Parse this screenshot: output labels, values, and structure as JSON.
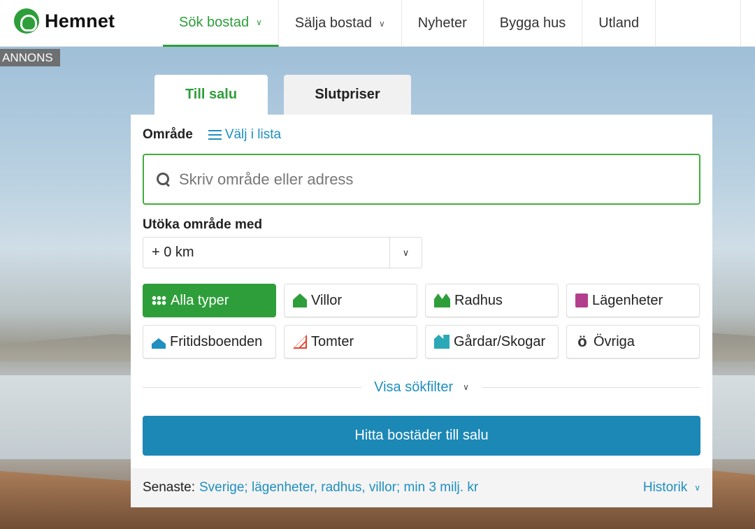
{
  "header": {
    "logo_text": "Hemnet",
    "nav": [
      {
        "label": "Sök bostad",
        "has_dropdown": true,
        "active": true
      },
      {
        "label": "Sälja bostad",
        "has_dropdown": true,
        "active": false
      },
      {
        "label": "Nyheter",
        "has_dropdown": false,
        "active": false
      },
      {
        "label": "Bygga hus",
        "has_dropdown": false,
        "active": false
      },
      {
        "label": "Utland",
        "has_dropdown": false,
        "active": false
      }
    ]
  },
  "ad_label": "ANNONS",
  "tabs": [
    {
      "label": "Till salu",
      "active": true
    },
    {
      "label": "Slutpriser",
      "active": false
    }
  ],
  "search": {
    "area_label": "Område",
    "choose_list_label": "Välj i lista",
    "placeholder": "Skriv område eller adress",
    "value": "",
    "extend_label": "Utöka område med",
    "extend_value": "+ 0 km"
  },
  "property_types": [
    {
      "label": "Alla typer",
      "icon": "grid-dots-icon",
      "selected": true
    },
    {
      "label": "Villor",
      "icon": "house-icon",
      "selected": false
    },
    {
      "label": "Radhus",
      "icon": "townhouse-icon",
      "selected": false
    },
    {
      "label": "Lägenheter",
      "icon": "apartment-icon",
      "selected": false
    },
    {
      "label": "Fritidsboenden",
      "icon": "vacation-house-icon",
      "selected": false
    },
    {
      "label": "Tomter",
      "icon": "plot-icon",
      "selected": false
    },
    {
      "label": "Gårdar/Skogar",
      "icon": "farm-icon",
      "selected": false
    },
    {
      "label": "Övriga",
      "icon": "other-icon",
      "selected": false
    }
  ],
  "filter_toggle_label": "Visa sökfilter",
  "submit_label": "Hitta bostäder till salu",
  "recent": {
    "label": "Senaste:",
    "value": "Sverige; lägenheter, radhus, villor; min 3 milj. kr",
    "history_label": "Historik"
  },
  "colors": {
    "brand_green": "#2e9e3a",
    "link_blue": "#1e8fbf",
    "button_blue": "#1c88b6"
  }
}
